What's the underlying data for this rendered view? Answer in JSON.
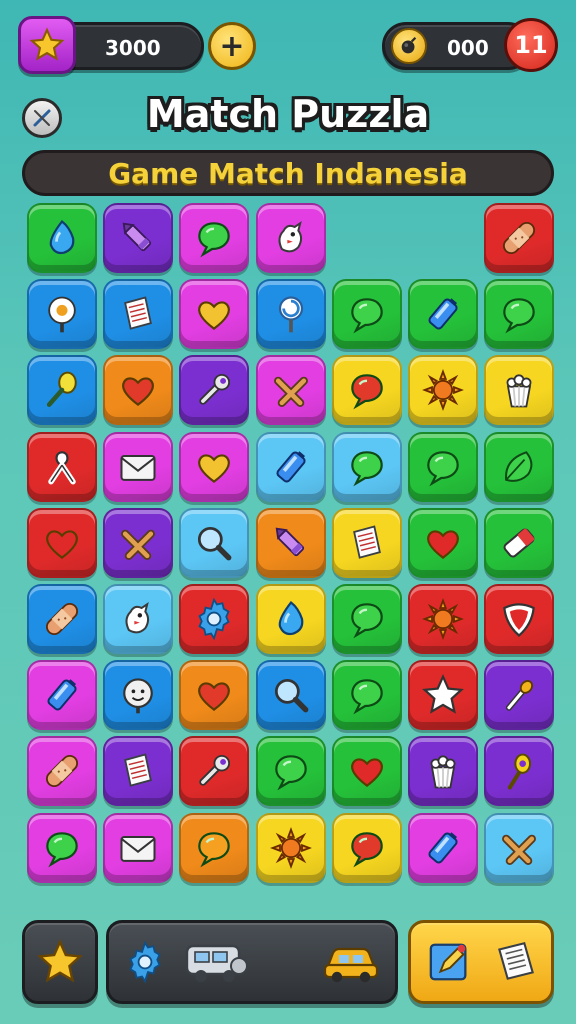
{
  "hud": {
    "score": "3000",
    "plus_label": "+",
    "counter": "000",
    "moves": "11"
  },
  "title": "Match Puzzla",
  "subtitle": "Game Match Indanesia",
  "colors": {
    "green": "#25c13a",
    "purple": "#7c2fd0",
    "magenta": "#e23ee2",
    "blue": "#1f8fe6",
    "red": "#e02a2a",
    "orange": "#f08a1a",
    "yellow": "#f6d620",
    "lightblue": "#5cc6f5"
  },
  "board": [
    [
      "green:drop-icon",
      "purple:crayon-icon",
      "magenta:speech-bubble-icon",
      "magenta:chicken-icon",
      "empty",
      "empty",
      "red:bandage-icon"
    ],
    [
      "blue:egg-icon",
      "blue:note-icon",
      "magenta:heart-icon",
      "blue:lollipop-icon",
      "green:speech-bubble-icon",
      "green:battery-icon",
      "green:speech-bubble-icon"
    ],
    [
      "blue:racket-icon",
      "orange:heart-icon",
      "purple:wrench-icon",
      "magenta:cross-icon",
      "yellow:speech-bubble-icon",
      "yellow:sun-icon",
      "yellow:popcorn-icon"
    ],
    [
      "red:ribbon-icon",
      "magenta:envelope-icon",
      "magenta:heart-icon",
      "lightblue:battery-icon",
      "lightblue:speech-bubble-icon",
      "green:speech-bubble-icon",
      "green:leaf-icon"
    ],
    [
      "red:heart-icon",
      "purple:cross-icon",
      "lightblue:magnifier-icon",
      "orange:crayon-icon",
      "yellow:note-icon",
      "green:heart-icon",
      "green:eraser-icon"
    ],
    [
      "blue:bandage-icon",
      "lightblue:chicken-icon",
      "red:gear-icon",
      "yellow:drop-icon",
      "green:speech-bubble-icon",
      "red:sun-icon",
      "red:shield-icon"
    ],
    [
      "magenta:battery-icon",
      "blue:face-icon",
      "orange:heart-icon",
      "blue:magnifier-icon",
      "green:speech-bubble-icon",
      "red:star-icon",
      "purple:match-icon"
    ],
    [
      "magenta:bandage-icon",
      "purple:note-icon",
      "red:wrench-icon",
      "green:speech-bubble-icon",
      "green:heart-icon",
      "purple:popcorn-icon",
      "purple:spoon-icon"
    ],
    [
      "magenta:speech-bubble-icon",
      "magenta:envelope-icon",
      "orange:speech-bubble-icon",
      "yellow:sun-icon",
      "yellow:speech-bubble-icon",
      "magenta:battery-icon",
      "lightblue:cross-icon"
    ]
  ],
  "bottom": {
    "left_icon": "star-icon",
    "middle_icons": [
      "gear-icon",
      "camper-van-icon",
      "taxi-icon"
    ],
    "right_icons": [
      "pencil-icon",
      "note-icon"
    ]
  }
}
